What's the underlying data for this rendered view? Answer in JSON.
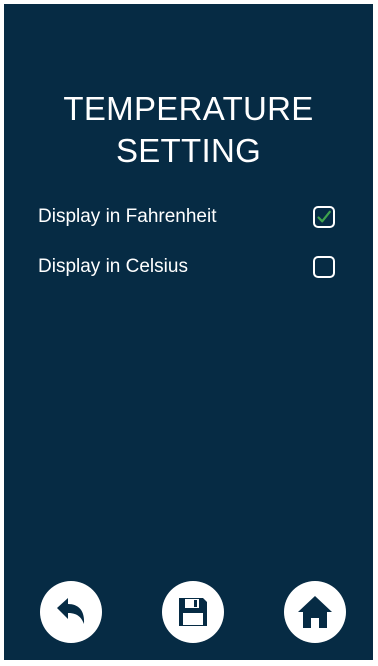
{
  "title": {
    "line1": "TEMPERATURE",
    "line2": "SETTING"
  },
  "options": [
    {
      "label": "Display in Fahrenheit",
      "checked": true
    },
    {
      "label": "Display in Celsius",
      "checked": false
    }
  ],
  "nav": {
    "back_icon": "back-arrow-icon",
    "save_icon": "floppy-disk-icon",
    "home_icon": "home-icon"
  },
  "colors": {
    "background": "#062b44",
    "check": "#3fa34d",
    "text": "#ffffff"
  }
}
